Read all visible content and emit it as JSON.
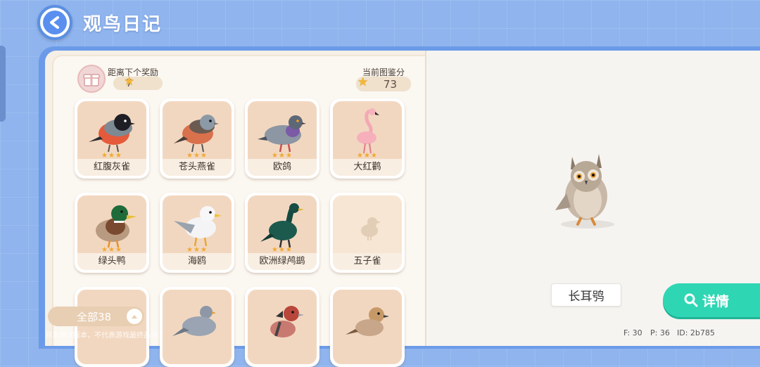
{
  "header": {
    "title": "观鸟日记"
  },
  "progress": {
    "reward_label": "距离下个奖励",
    "reward_value": "7",
    "score_label": "当前图鉴分",
    "score_value": "73"
  },
  "birds": [
    {
      "name": "红腹灰雀",
      "stars": "★★★",
      "icon": "bullfinch"
    },
    {
      "name": "苍头燕雀",
      "stars": "★★★",
      "icon": "chaffinch"
    },
    {
      "name": "欧鸽",
      "stars": "★★★",
      "icon": "pigeon"
    },
    {
      "name": "大红鹳",
      "stars": "★★★",
      "icon": "flamingo"
    },
    {
      "name": "绿头鸭",
      "stars": "★★★",
      "icon": "mallard"
    },
    {
      "name": "海鸥",
      "stars": "★★★",
      "icon": "gull"
    },
    {
      "name": "欧洲绿鸬鹚",
      "stars": "★★★",
      "icon": "shag"
    },
    {
      "name": "五子雀",
      "stars": "",
      "icon": "locked-bird"
    }
  ],
  "filter": {
    "label": "全部38"
  },
  "disclaimer": "开发测试版本，不代表游戏最终品质",
  "selected": {
    "name": "长耳鸮",
    "icon": "long-eared-owl"
  },
  "detail_button": {
    "label": "详情"
  },
  "debug": {
    "f": "F: 30",
    "p": "P: 36",
    "id": "ID: 2b785"
  },
  "colors": {
    "accent": "#2fd6b4",
    "header_blue": "#8fb4ee",
    "star": "#f4b73a"
  }
}
